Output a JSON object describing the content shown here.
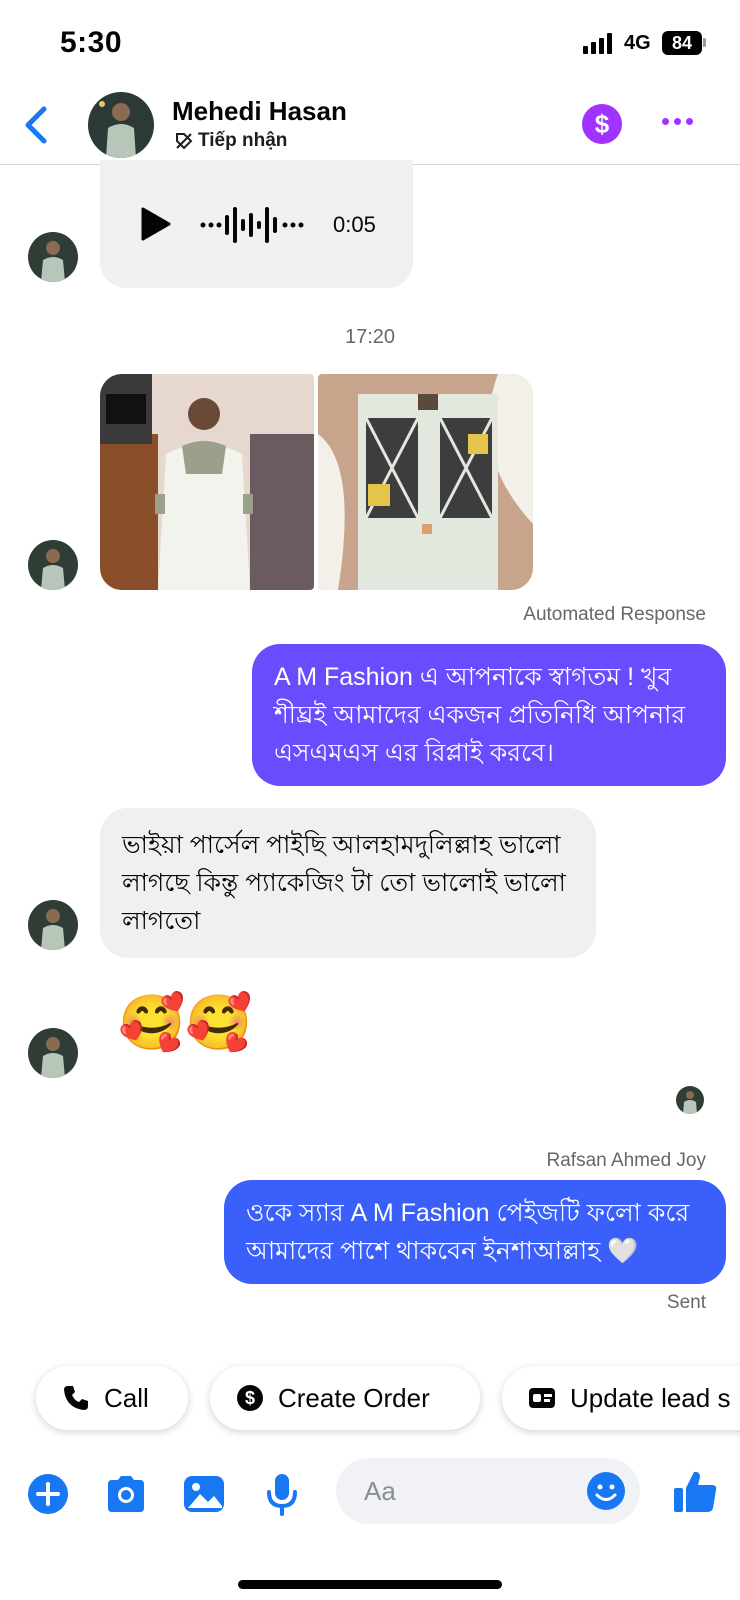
{
  "status_bar": {
    "time": "5:30",
    "network": "4G",
    "battery": "84"
  },
  "header": {
    "contact_name": "Mehedi Hasan",
    "contact_status": "Tiếp nhận",
    "payment_icon": "dollar-icon",
    "more_icon": "more-dots-icon",
    "accent_color": "#a033ff"
  },
  "conversation": {
    "voice_message": {
      "duration": "0:05"
    },
    "time_divider": "17:20",
    "automated_label": "Automated Response",
    "automated_message": "A M Fashion এ আপনাকে স্বাগতম ! খুব শীঘ্রই আমাদের একজন প্রতিনিধি আপনার এসএমএস এর রিপ্লাই করবে।",
    "automated_color": "#6a4cff",
    "incoming_message": "ভাইয়া পার্সেল পাইছি আলহামদুলিল্লাহ ভালো লাগছে কিন্তু প্যাকেজিং টা তো ভালোই ভালো লাগতো",
    "emoji_message": "🥰🥰",
    "sender_label": "Rafsan Ahmed Joy",
    "reply_message": "ওকে স্যার A M Fashion পেইজটি ফলো করে আমাদের পাশে থাকবেন ইনশাআল্লাহ 🤍",
    "reply_color": "#3a5ffb",
    "sent_status": "Sent"
  },
  "quick_replies": [
    {
      "label": "Call",
      "icon": "phone-icon"
    },
    {
      "label": "Create Order",
      "icon": "dollar-circle-icon"
    },
    {
      "label": "Update lead s",
      "icon": "id-card-icon"
    }
  ],
  "composer": {
    "placeholder": "Aa",
    "icons": [
      "plus-icon",
      "camera-icon",
      "image-icon",
      "microphone-icon",
      "emoji-icon",
      "like-icon"
    ],
    "icon_color": "#1877f2"
  }
}
